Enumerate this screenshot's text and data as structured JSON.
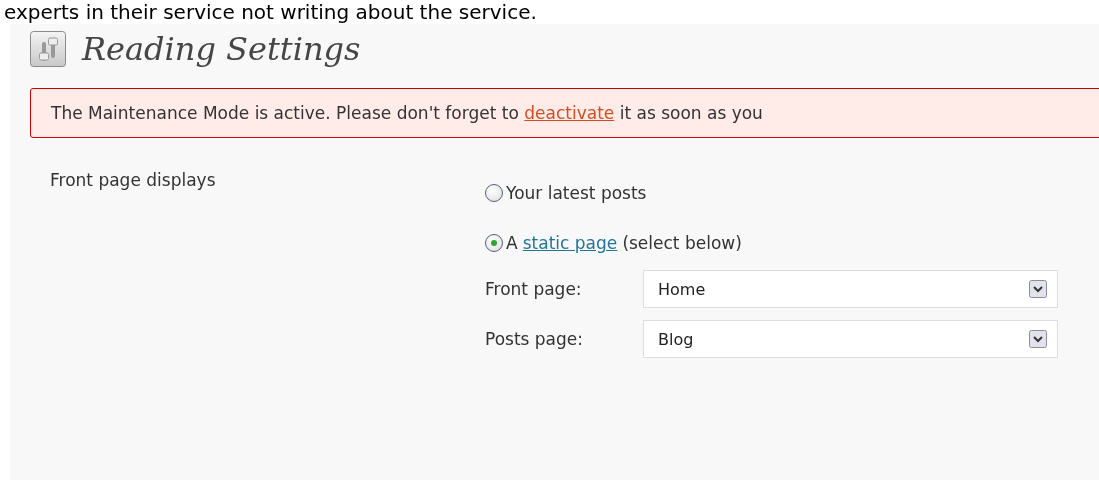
{
  "top_text": "experts in their service not writing about the service.",
  "page": {
    "title": "Reading Settings"
  },
  "notice": {
    "before": "The Maintenance Mode is active. Please don't forget to",
    "link": "deactivate",
    "after": "it as soon as you"
  },
  "front_page_displays": {
    "label": "Front page displays",
    "options": [
      {
        "before": "Your latest posts",
        "selected": false
      },
      {
        "before": "A",
        "link": "static page",
        "after": "(select below)",
        "selected": true
      }
    ],
    "selects": [
      {
        "label": "Front page:",
        "value": "Home"
      },
      {
        "label": "Posts page:",
        "value": "Blog"
      }
    ]
  }
}
